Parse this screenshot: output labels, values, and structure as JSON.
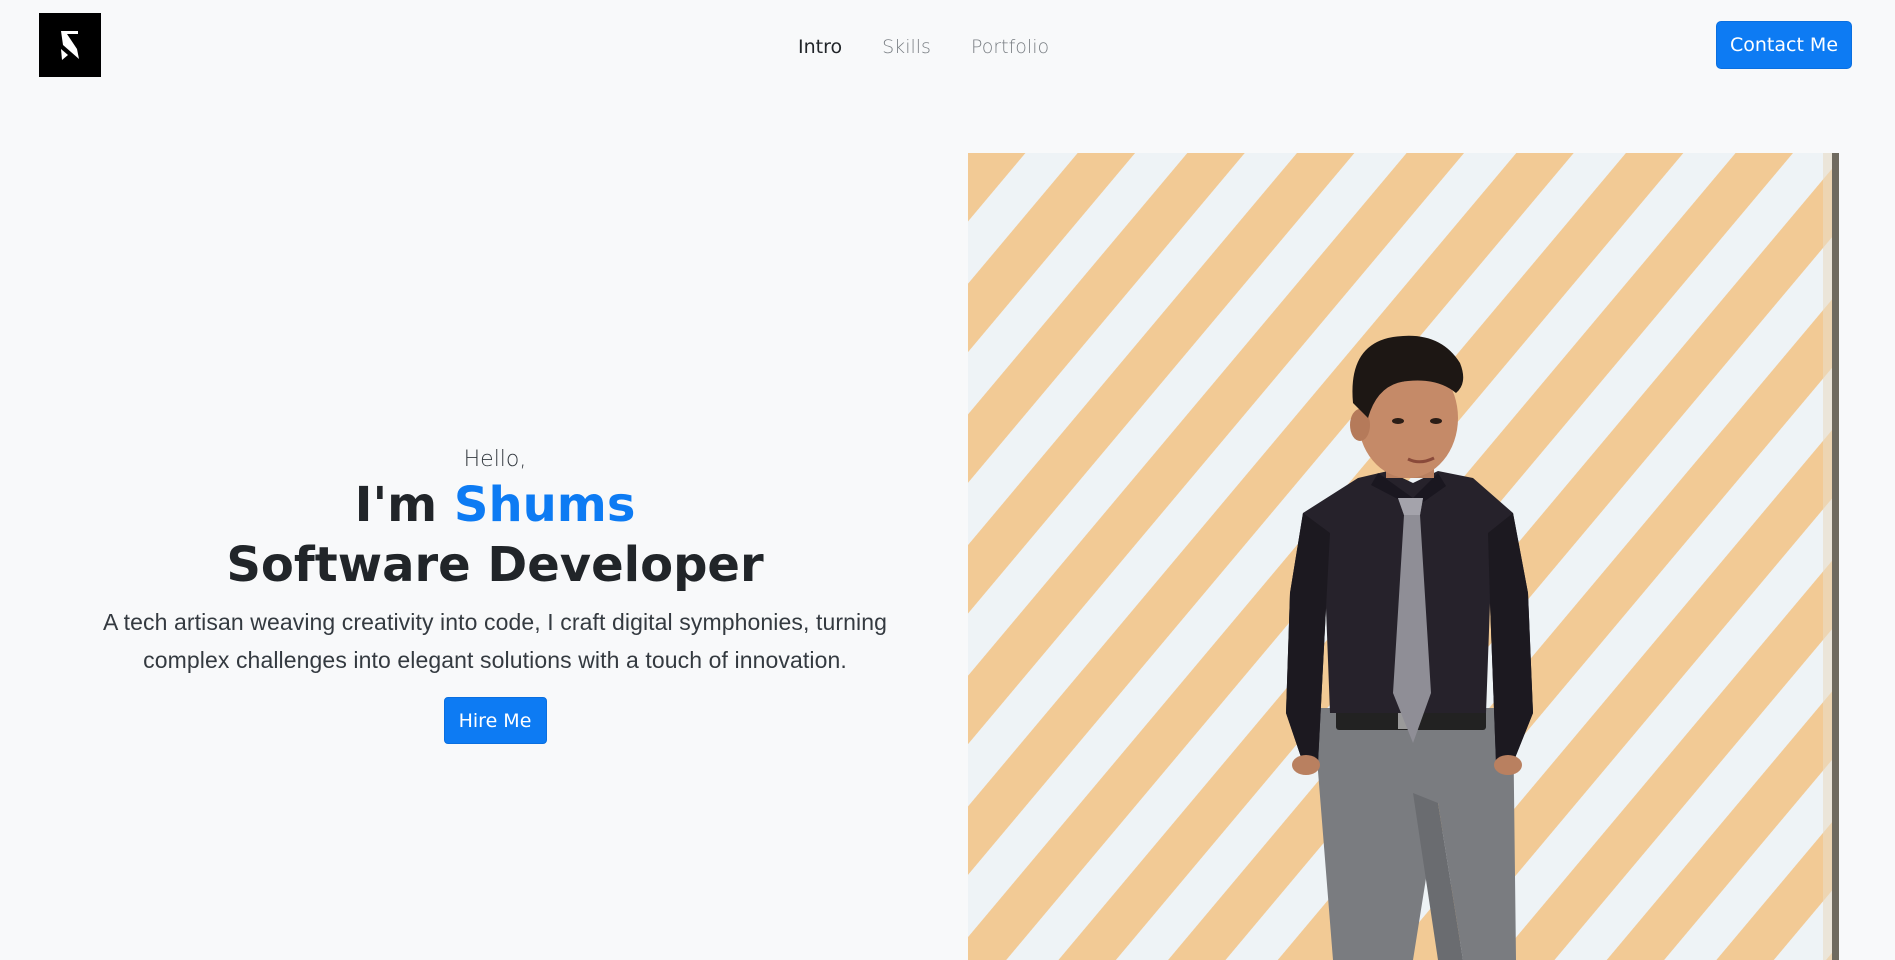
{
  "nav": {
    "brand_logo_letter": "S",
    "links": [
      {
        "label": "Intro",
        "active": true
      },
      {
        "label": "Skills",
        "active": false
      },
      {
        "label": "Portfolio",
        "active": false
      }
    ],
    "contact_label": "Contact Me"
  },
  "hero": {
    "greeting": "Hello,",
    "intro_prefix": "I'm ",
    "name": "Shums",
    "role": "Software Developer",
    "description": "A tech artisan weaving creativity into code, I craft digital symphonies, turning complex challenges into elegant solutions with a touch of innovation.",
    "hire_label": "Hire Me"
  },
  "colors": {
    "accent": "#0d7bf3",
    "background": "#f8f9fa",
    "stripe": "#f2ca95"
  },
  "icons": {
    "brand": "brand-logo-icon"
  }
}
